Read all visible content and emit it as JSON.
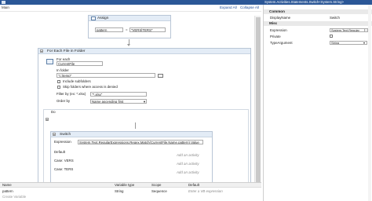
{
  "titlebar": {
    "text": "System.Activities.Statements.Switch<System.String>"
  },
  "designer": {
    "breadcrumb": "Main",
    "expand_all": "Expand All",
    "collapse_all": "Collapse All"
  },
  "assign": {
    "title": "Assign",
    "to": "pattern",
    "operator": "=",
    "value": "VERS|TERS"
  },
  "foreach": {
    "title": "For Each File in Folder",
    "for_each_label": "For each",
    "for_each_value": "CurrentFile",
    "in_folder_label": "In folder",
    "in_folder_value": "\"c:\\temp\"",
    "include_subfolders": "Include subfolders",
    "skip_folders": "Skip folders where access is denied",
    "filter_label": "Filter by (ex: *.xlsx)",
    "filter_value": "\"*.xlsx\"",
    "order_label": "Order by",
    "order_value": "Name ascending first"
  },
  "do": {
    "title": "Do"
  },
  "switch": {
    "title": "Switch",
    "expression_label": "Expression",
    "expression_value": "System.Text.RegularExpressions.Regex.Match(CurrentFile.Name,pattern).Value",
    "default_label": "Default",
    "add_activity": "Add an activity",
    "cases": [
      {
        "label": "Case: VERS",
        "hint": "Add an activity"
      },
      {
        "label": "Case: TERS",
        "hint": "Add an activity"
      }
    ]
  },
  "variables": {
    "headers": [
      "Name",
      "Variable type",
      "Scope",
      "Default"
    ],
    "rows": [
      {
        "name": "pattern",
        "type": "String",
        "scope": "Sequence",
        "default": "Enter a VB expression"
      }
    ],
    "create": "Create Variable"
  },
  "properties": {
    "sections": [
      "Common",
      "Misc"
    ],
    "rows": [
      {
        "name": "DisplayName",
        "value": "Switch"
      },
      {
        "name": "Expression",
        "value": "System.Text.Regular"
      },
      {
        "name": "Private",
        "value": ""
      },
      {
        "name": "TypeArgument",
        "value": "String"
      }
    ]
  }
}
